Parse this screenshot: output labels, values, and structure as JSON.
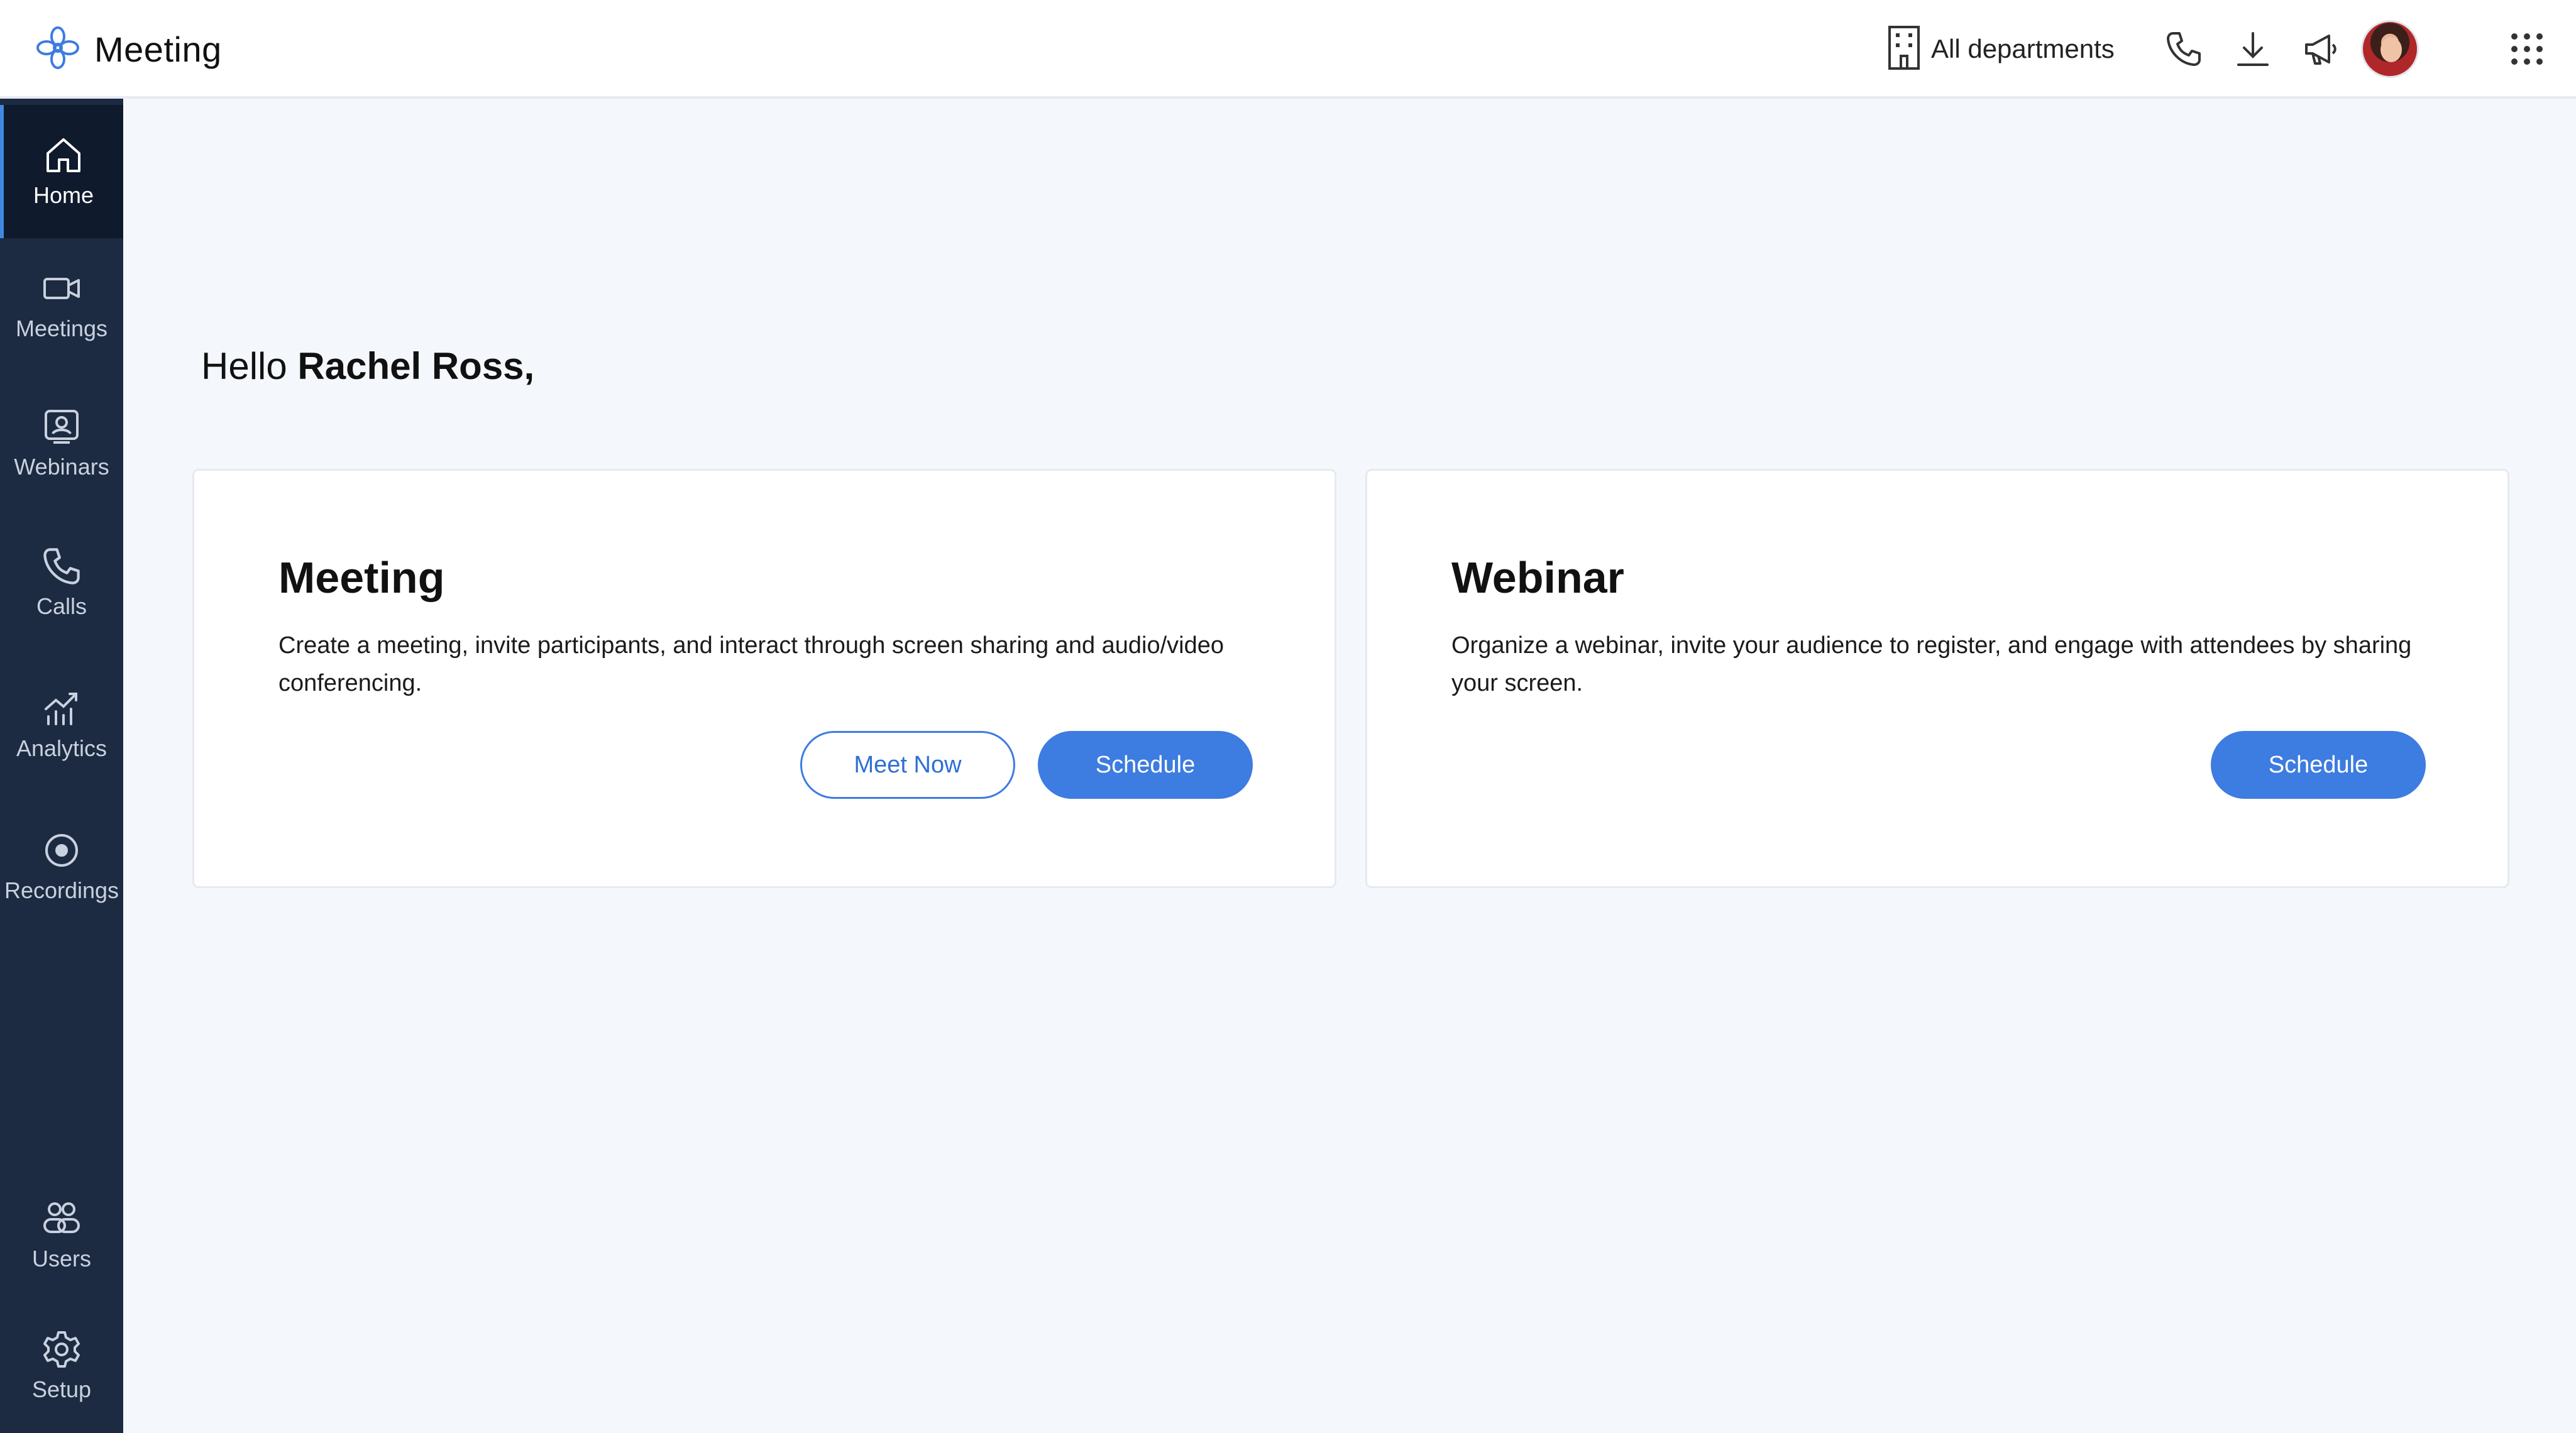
{
  "app": {
    "title": "Meeting",
    "logo_icon": "flower-logo-icon"
  },
  "header": {
    "department_label": "All departments",
    "icons": [
      "building-icon",
      "phone-icon",
      "download-icon",
      "megaphone-icon",
      "avatar",
      "apps-grid-icon"
    ]
  },
  "sidebar": {
    "items": [
      {
        "label": "Home",
        "icon": "home-icon",
        "active": true
      },
      {
        "label": "Meetings",
        "icon": "video-camera-icon"
      },
      {
        "label": "Webinars",
        "icon": "webinar-icon"
      },
      {
        "label": "Calls",
        "icon": "phone-icon"
      },
      {
        "label": "Analytics",
        "icon": "analytics-icon"
      },
      {
        "label": "Recordings",
        "icon": "record-icon"
      },
      {
        "label": "Users",
        "icon": "users-icon"
      },
      {
        "label": "Setup",
        "icon": "gear-icon"
      }
    ]
  },
  "main": {
    "greeting_prefix": "Hello ",
    "user_name": "Rachel Ross,",
    "cards": [
      {
        "title": "Meeting",
        "description": "Create a meeting, invite participants, and interact through screen sharing and audio/video conferencing.",
        "buttons": [
          "Meet Now",
          "Schedule"
        ]
      },
      {
        "title": "Webinar",
        "description": "Organize a webinar, invite your audience to register, and engage with attendees by sharing your screen.",
        "buttons": [
          "Schedule"
        ]
      }
    ]
  },
  "colors": {
    "accent": "#3d7ce0",
    "sidebar_bg": "#1c2a42",
    "page_bg": "#f4f7fc"
  }
}
